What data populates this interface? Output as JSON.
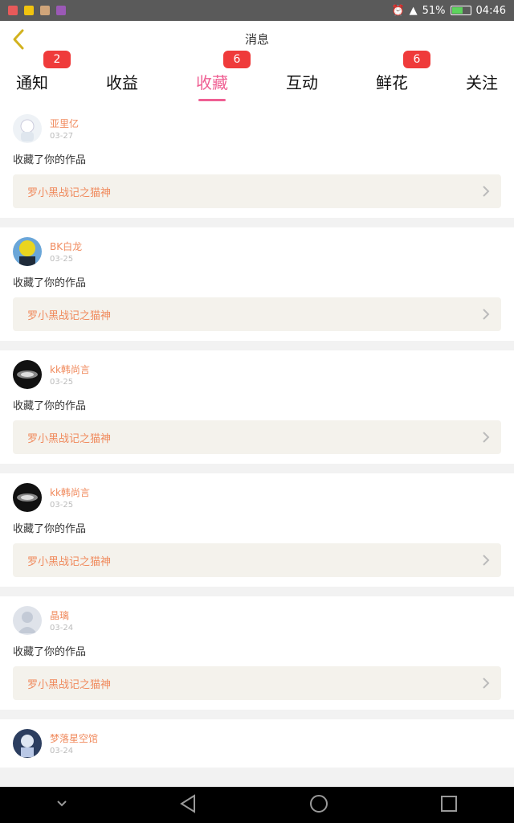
{
  "status_bar": {
    "battery_percent": "51%",
    "time": "04:46",
    "icons": [
      "app-icon-1",
      "app-icon-2",
      "app-icon-3",
      "app-icon-4",
      "alarm-icon",
      "signal-icon",
      "battery-icon"
    ]
  },
  "header": {
    "title": "消息"
  },
  "tabs": [
    {
      "label": "通知",
      "badge": "2",
      "active": false
    },
    {
      "label": "收益",
      "badge": "",
      "active": false
    },
    {
      "label": "收藏",
      "badge": "6",
      "active": true
    },
    {
      "label": "互动",
      "badge": "",
      "active": false
    },
    {
      "label": "鲜花",
      "badge": "6",
      "active": false
    },
    {
      "label": "关注",
      "badge": "",
      "active": false
    }
  ],
  "feed": [
    {
      "username": "亚里亿",
      "date": "03-27",
      "action": "收藏了你的作品",
      "work_title": "罗小黑战记之猫神"
    },
    {
      "username": "BK白龙",
      "date": "03-25",
      "action": "收藏了你的作品",
      "work_title": "罗小黑战记之猫神"
    },
    {
      "username": "kk韩尚言",
      "date": "03-25",
      "action": "收藏了你的作品",
      "work_title": "罗小黑战记之猫神"
    },
    {
      "username": "kk韩尚言",
      "date": "03-25",
      "action": "收藏了你的作品",
      "work_title": "罗小黑战记之猫神"
    },
    {
      "username": "晶璃",
      "date": "03-24",
      "action": "收藏了你的作品",
      "work_title": "罗小黑战记之猫神"
    },
    {
      "username": "梦落星空馆",
      "date": "03-24",
      "action": "",
      "work_title": ""
    }
  ],
  "colors": {
    "accent": "#ef5f93",
    "badge": "#ef3b3b",
    "username": "#f08a5d"
  }
}
